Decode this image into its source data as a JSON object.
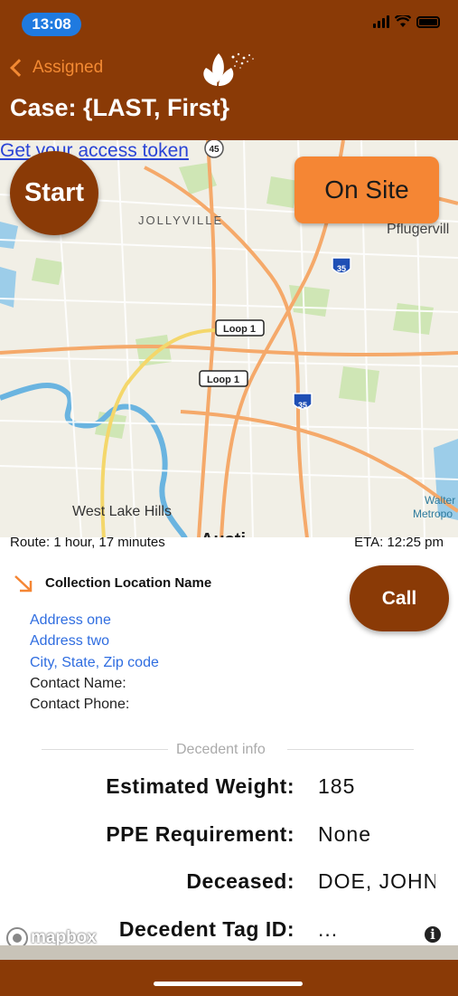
{
  "status_bar": {
    "time": "13:08"
  },
  "header": {
    "back_label": "Assigned",
    "title": "Case: {LAST, First}"
  },
  "map": {
    "access_token_link": "Get your access token",
    "labels": {
      "jollyville": "JOLLYVILLE",
      "pflugerville": "Pflugervill",
      "west_lake_hills": "West Lake Hills",
      "walter": "Walter",
      "metropo": "Metropo",
      "loop1_a": "Loop 1",
      "loop1_b": "Loop 1",
      "hwy45": "45",
      "i35_a": "35",
      "i35_b": "35",
      "austin_partial": "Austi"
    },
    "start_label": "Start",
    "onsite_label": "On Site"
  },
  "route": {
    "duration": "Route: 1 hour, 17 minutes",
    "eta": "ETA: 12:25 pm"
  },
  "location": {
    "name": "Collection Location Name",
    "address_one": "Address one",
    "address_two": "Address two",
    "city_state_zip": "City, State, Zip code",
    "contact_name_label": "Contact Name:",
    "contact_phone_label": "Contact Phone:",
    "call_label": "Call"
  },
  "decedent": {
    "section_label": "Decedent info",
    "rows": [
      {
        "label": "Estimated Weight:",
        "value": "185"
      },
      {
        "label": "PPE Requirement:",
        "value": "None"
      },
      {
        "label": "Deceased:",
        "value": "DOE, JOHN"
      },
      {
        "label": "Decedent Tag ID:",
        "value": "..."
      }
    ]
  },
  "mapbox": {
    "logo_text": "mapbox",
    "info_symbol": "i"
  },
  "colors": {
    "brand": "#8a3a06",
    "accent": "#f58634",
    "link": "#2f6de0",
    "status_pill": "#1f7ae0"
  },
  "icons": {
    "back": "chevron-left-icon",
    "logo": "leaf-logo-icon",
    "location": "arrow-down-right-icon",
    "info": "info-icon"
  }
}
